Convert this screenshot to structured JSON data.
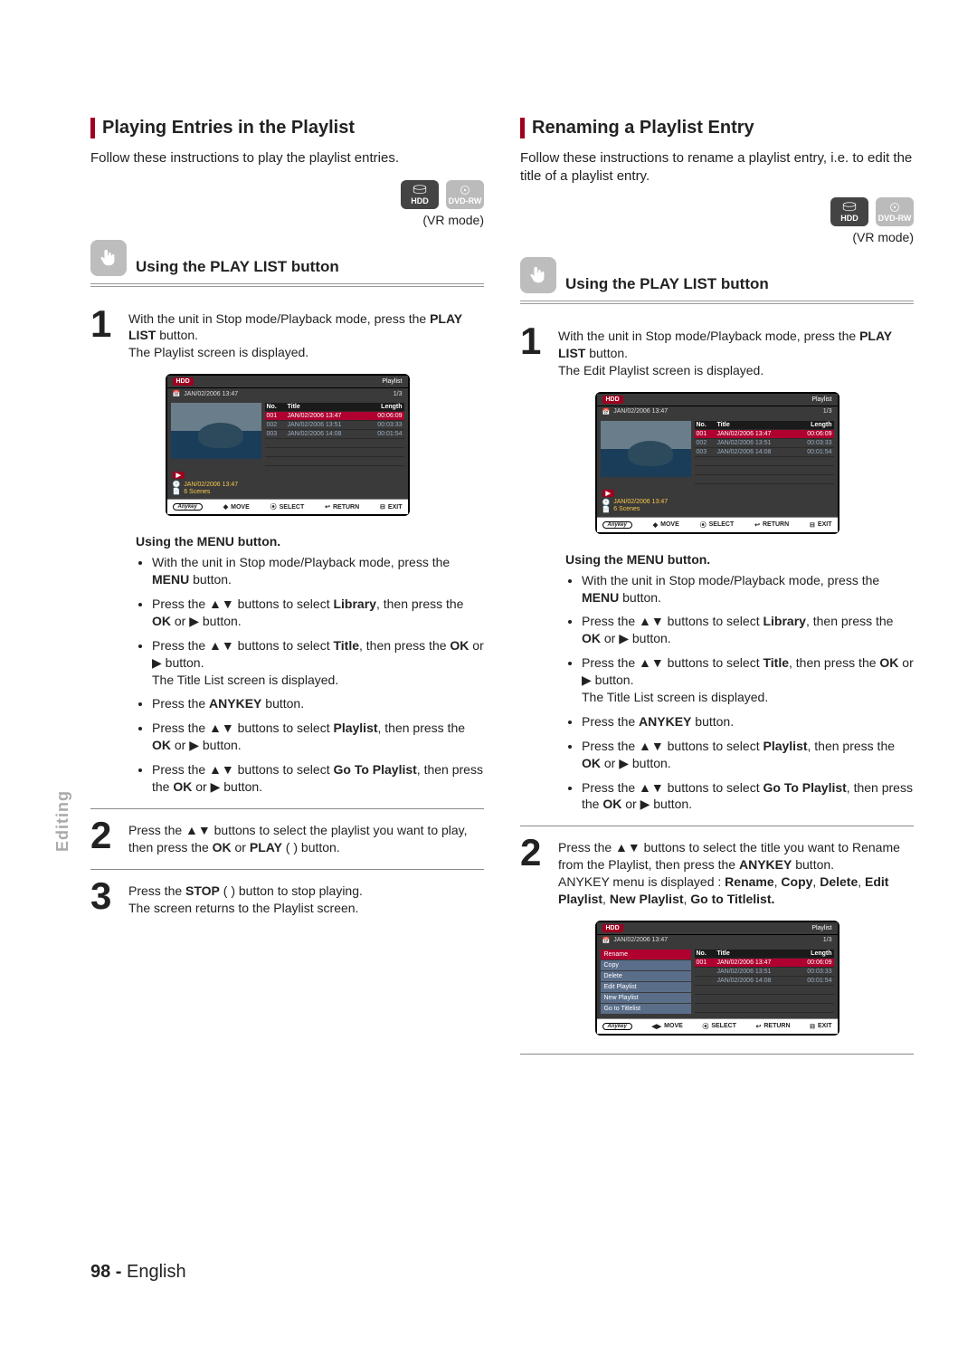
{
  "sidetab": "Editing",
  "footer": {
    "page": "98 -",
    "lang": "English"
  },
  "badge": {
    "hdd": "HDD",
    "dvd": "DVD-RW"
  },
  "vr": "(VR mode)",
  "left": {
    "title": "Playing Entries in the Playlist",
    "intro": "Follow these instructions to play the playlist entries.",
    "sub": "Using the PLAY LIST button",
    "s1": {
      "l1": "With the unit in Stop mode/Playback mode, press the",
      "b1": "PLAY LIST",
      "l2": " button.",
      "l3": "The Playlist screen is displayed."
    },
    "menu_sub": "Using the MENU button.",
    "m1a": "With the unit in Stop mode/Playback mode, press the ",
    "m1b": "MENU",
    "m1c": " button.",
    "m2a": "Press the ▲▼ buttons to select ",
    "m2b": "Library",
    "m2c": ", then press the ",
    "m2d": "OK",
    "m2e": " or ▶ button.",
    "m3a": "Press the ▲▼ buttons to select ",
    "m3b": "Title",
    "m3c": ", then press the ",
    "m3d": "OK",
    "m3e": " or ▶ button.",
    "m3f": "The Title List screen is displayed.",
    "m4a": "Press the ",
    "m4b": "ANYKEY",
    "m4c": " button.",
    "m5a": "Press the ▲▼ buttons to select ",
    "m5b": "Playlist",
    "m5c": ", then press the ",
    "m5d": "OK",
    "m5e": " or ▶ button.",
    "m6a": "Press the ▲▼ buttons to select ",
    "m6b": "Go To Playlist",
    "m6c": ", then press the ",
    "m6d": "OK",
    "m6e": " or ▶ button.",
    "s2": {
      "l1": "Press the ▲▼ buttons to select the playlist you want to play, then press the ",
      "b1": "OK",
      "l2": " or ",
      "b2": "PLAY",
      "l3": " (   ) button."
    },
    "s3": {
      "l1": "Press the ",
      "b1": "STOP",
      "l2": " (   )  button to stop playing.",
      "l3": "The screen returns to the Playlist screen."
    }
  },
  "right": {
    "title": "Renaming a Playlist Entry",
    "intro": "Follow these instructions to rename a playlist entry, i.e. to edit the title of a playlist entry.",
    "sub": "Using the PLAY LIST button",
    "s1": {
      "l1": "With the unit in Stop mode/Playback mode, press the",
      "b1": "PLAY LIST",
      "l2": " button.",
      "l3": "The Edit Playlist screen is displayed."
    },
    "menu_sub": "Using the MENU button.",
    "m1a": "With the unit in Stop mode/Playback mode, press the ",
    "m1b": "MENU",
    "m1c": " button.",
    "m2a": "Press the ▲▼ buttons to select ",
    "m2b": "Library",
    "m2c": ", then press the ",
    "m2d": "OK",
    "m2e": " or ▶ button.",
    "m3a": "Press the ▲▼ buttons to select ",
    "m3b": "Title",
    "m3c": ", then press the ",
    "m3d": "OK",
    "m3e": " or ▶ button.",
    "m3f": "The Title List screen is displayed.",
    "m4a": "Press the ",
    "m4b": "ANYKEY",
    "m4c": " button.",
    "m5a": "Press the ▲▼ buttons to select ",
    "m5b": "Playlist",
    "m5c": ", then press the ",
    "m5d": "OK",
    "m5e": " or ▶ button.",
    "m6a": "Press the ▲▼ buttons to select ",
    "m6b": "Go To Playlist",
    "m6c": ", then press the ",
    "m6d": "OK",
    "m6e": " or ▶ button.",
    "s2": {
      "l1": "Press the ▲▼ buttons to select the title you want to Rename from the Playlist, then press the ",
      "b1": "ANYKEY",
      "l2": " button.",
      "l3": "ANYKEY menu is displayed : ",
      "b2": "Rename",
      "c1": ", ",
      "b3": "Copy",
      "c2": ", ",
      "b4": "Delete",
      "c3": ", ",
      "b5": "Edit Playlist",
      "c4": ", ",
      "b6": "New Playlist",
      "c5": ", ",
      "b7": "Go to Titlelist."
    }
  },
  "tv": {
    "hdd": "HDD",
    "label": "Playlist",
    "ts": "JAN/02/2006 13:47",
    "counter": "1/3",
    "hdr_no": "No.",
    "hdr_title": "Title",
    "hdr_len": "Length",
    "r1_no": "001",
    "r1_t": "JAN/02/2006 13:47",
    "r1_l": "00:06:09",
    "r2_no": "002",
    "r2_t": "JAN/02/2006 13:51",
    "r2_l": "00:03:33",
    "r3_no": "003",
    "r3_t": "JAN/02/2006 14:08",
    "r3_l": "00:01:54",
    "info_ts": "JAN/02/2006 13:47",
    "info_scenes": "6 Scenes",
    "bot_move": "MOVE",
    "bot_sel": "SELECT",
    "bot_ret": "RETURN",
    "bot_exit": "EXIT",
    "bot_key": "Anykey"
  },
  "ctx": {
    "rename": "Rename",
    "copy": "Copy",
    "delete": "Delete",
    "edit": "Edit Playlist",
    "new": "New Playlist",
    "go": "Go to Titlelist"
  }
}
